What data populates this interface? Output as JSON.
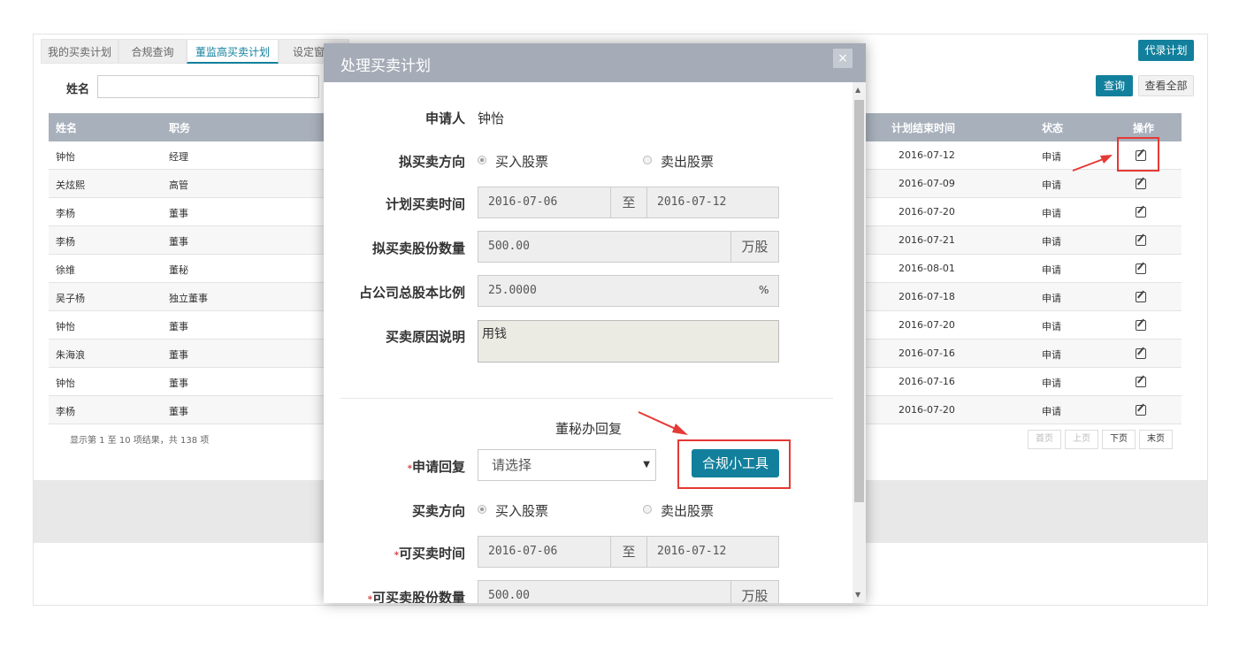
{
  "tabs": [
    {
      "label": "我的买卖计划",
      "active": false
    },
    {
      "label": "合规查询",
      "active": false
    },
    {
      "label": "董监高买卖计划",
      "active": true
    },
    {
      "label": "设定窗口",
      "active": false
    }
  ],
  "toolbar": {
    "proxy_button": "代录计划",
    "name_label": "姓名",
    "name_value": "",
    "query_button": "查询",
    "view_all_button": "查看全部"
  },
  "table": {
    "headers": {
      "name": "姓名",
      "position": "职务",
      "end_time": "计划结束时间",
      "status": "状态",
      "action": "操作"
    },
    "rows": [
      {
        "name": "钟怡",
        "position": "经理",
        "end": "2016-07-12",
        "status": "申请"
      },
      {
        "name": "关炫熙",
        "position": "高管",
        "end": "2016-07-09",
        "status": "申请"
      },
      {
        "name": "李杨",
        "position": "董事",
        "end": "2016-07-20",
        "status": "申请"
      },
      {
        "name": "李杨",
        "position": "董事",
        "end": "2016-07-21",
        "status": "申请"
      },
      {
        "name": "徐维",
        "position": "董秘",
        "end": "2016-08-01",
        "status": "申请"
      },
      {
        "name": "吴子杨",
        "position": "独立董事",
        "end": "2016-07-18",
        "status": "申请"
      },
      {
        "name": "钟怡",
        "position": "董事",
        "end": "2016-07-20",
        "status": "申请"
      },
      {
        "name": "朱海浪",
        "position": "董事",
        "end": "2016-07-16",
        "status": "申请"
      },
      {
        "name": "钟怡",
        "position": "董事",
        "end": "2016-07-16",
        "status": "申请"
      },
      {
        "name": "李杨",
        "position": "董事",
        "end": "2016-07-20",
        "status": "申请"
      }
    ],
    "footer_info": "显示第 1 至 10 项结果，共 138 项",
    "pager": {
      "first": "首页",
      "prev": "上页",
      "next": "下页",
      "last": "末页"
    }
  },
  "modal": {
    "title": "处理买卖计划",
    "close_symbol": "×",
    "applicant_label": "申请人",
    "applicant_value": "钟怡",
    "direction_label": "拟买卖方向",
    "direction_buy": "买入股票",
    "direction_sell": "卖出股票",
    "direction_selected": "buy",
    "plan_time_label": "计划买卖时间",
    "plan_time_start": "2016-07-06",
    "plan_time_sep": "至",
    "plan_time_end": "2016-07-12",
    "shares_label": "拟买卖股份数量",
    "shares_value": "500.00",
    "shares_unit": "万股",
    "ratio_label": "占公司总股本比例",
    "ratio_value": "25.0000",
    "ratio_unit": "%",
    "reason_label": "买卖原因说明",
    "reason_value": "用钱",
    "reply_section_title": "董秘办回复",
    "reply_label": "申请回复",
    "reply_required": "*",
    "reply_select": "请选择",
    "tool_button": "合规小工具",
    "reply_direction_label": "买卖方向",
    "reply_direction_buy": "买入股票",
    "reply_direction_sell": "卖出股票",
    "reply_time_label": "可买卖时间",
    "reply_time_required": "*",
    "reply_time_start": "2016-07-06",
    "reply_time_sep": "至",
    "reply_time_end": "2016-07-12",
    "reply_shares_label": "可买卖股份数量",
    "reply_shares_required": "*",
    "reply_shares_value": "500.00",
    "reply_shares_unit": "万股"
  }
}
